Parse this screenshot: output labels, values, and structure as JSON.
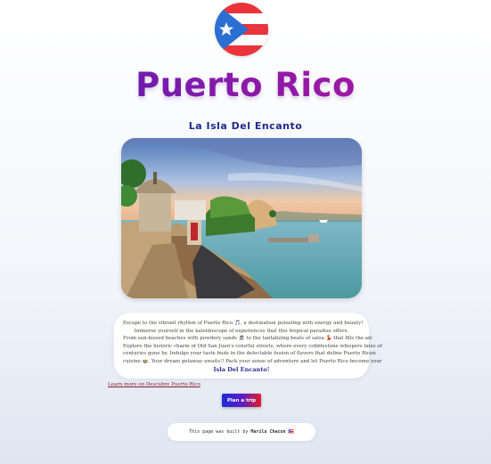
{
  "header": {
    "flag_icon": "puerto-rico-flag",
    "title": "Puerto Rico",
    "subtitle": "La Isla Del Encanto"
  },
  "photo": {
    "subject": "Old San Juan fort and coastline"
  },
  "intro": {
    "lines": [
      "Escape to the vibrant rhythm of Puerto Rico 🎵, a destination pulsating with energy and beauty!",
      "Immerse yourself in the kaleidoscope of experiences that this tropical paradise offers.",
      "From sun-kissed beaches with powdery sands 🏖 to the tantalizing beats of salsa 💃 that fills the air.",
      "Explore the historic charm of Old San Juan's colorful streets, where every cobblestone whispers tales of",
      "centuries gone by. Indulge your taste buds in the delectable fusion of flavors that define Puerto Rican",
      "cuisine 🍲. Your dream getaway awaits!! Pack your sense of adventure and let Puerto Rico become your"
    ],
    "emphasis": "Isla Del Encanto!"
  },
  "links": {
    "learn_more": "Learn more on Descubre Puerto Rico"
  },
  "buttons": {
    "plan_trip": "Plan a trip"
  },
  "footer": {
    "prefix": "This page was built by",
    "author": "Marilu Chacon",
    "emoji": "🇵🇷"
  },
  "colors": {
    "title_gradient": [
      "#4b1fb3",
      "#c0169b"
    ],
    "subtitle": "#1f2a8a",
    "button_gradient": [
      "#1d2bd8",
      "#e31b2a"
    ],
    "link": "#8b1e2b"
  }
}
